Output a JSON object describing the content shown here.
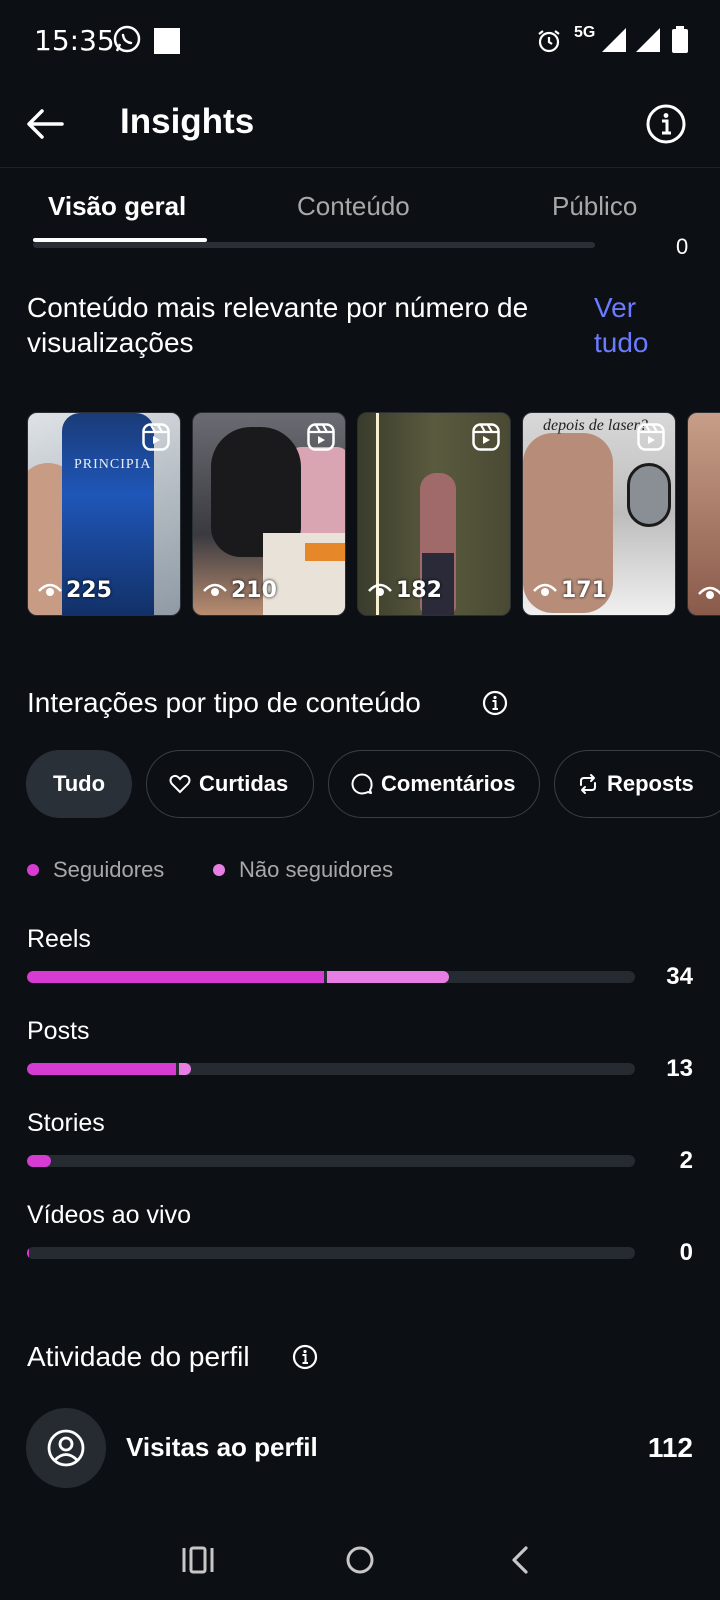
{
  "status_bar": {
    "time": "15:35",
    "network": "5G"
  },
  "header": {
    "title": "Insights",
    "back_icon": "arrow-left-icon",
    "info_icon": "info-icon"
  },
  "tabs": [
    {
      "label": "Visão geral",
      "active": true
    },
    {
      "label": "Conteúdo",
      "active": false
    },
    {
      "label": "Público",
      "active": false
    }
  ],
  "scroll_remnant": {
    "value": "0"
  },
  "top_content": {
    "title": "Conteúdo mais relevante por número de visualizações",
    "see_all": "Ver tudo",
    "thumbnails": [
      {
        "views": "225",
        "type": "reel",
        "overlay_text": "PRINCIPIA"
      },
      {
        "views": "210",
        "type": "reel",
        "overlay_text": ""
      },
      {
        "views": "182",
        "type": "reel",
        "overlay_text": ""
      },
      {
        "views": "171",
        "type": "reel",
        "overlay_text": "depois de laser?"
      },
      {
        "views": "",
        "type": "reel",
        "overlay_text": ""
      }
    ]
  },
  "interactions": {
    "title": "Interações por tipo de conteúdo",
    "filters": [
      {
        "label": "Tudo",
        "icon": "",
        "selected": true
      },
      {
        "label": "Curtidas",
        "icon": "heart-icon",
        "selected": false
      },
      {
        "label": "Comentários",
        "icon": "comment-icon",
        "selected": false
      },
      {
        "label": "Reposts",
        "icon": "repost-icon",
        "selected": false
      }
    ],
    "legend": [
      {
        "label": "Seguidores",
        "color": "#d63bd2"
      },
      {
        "label": "Não seguidores",
        "color": "#e77ee3"
      }
    ],
    "rows": [
      {
        "label": "Reels",
        "value": "34",
        "followers_fraction": 0.488,
        "non_followers_fraction": 0.2
      },
      {
        "label": "Posts",
        "value": "13",
        "followers_fraction": 0.245,
        "non_followers_fraction": 0.02
      },
      {
        "label": "Stories",
        "value": "2",
        "followers_fraction": 0.04,
        "non_followers_fraction": 0.0
      },
      {
        "label": "Vídeos ao vivo",
        "value": "0",
        "followers_fraction": 0.004,
        "non_followers_fraction": 0.0
      }
    ]
  },
  "profile_activity": {
    "title": "Atividade do perfil",
    "visits_label": "Visitas ao perfil",
    "visits_value": "112"
  },
  "colors": {
    "background": "#0c1014",
    "accent_link": "#6a7bff",
    "followers": "#d63bd2",
    "non_followers": "#e77ee3",
    "track": "#262b32"
  }
}
